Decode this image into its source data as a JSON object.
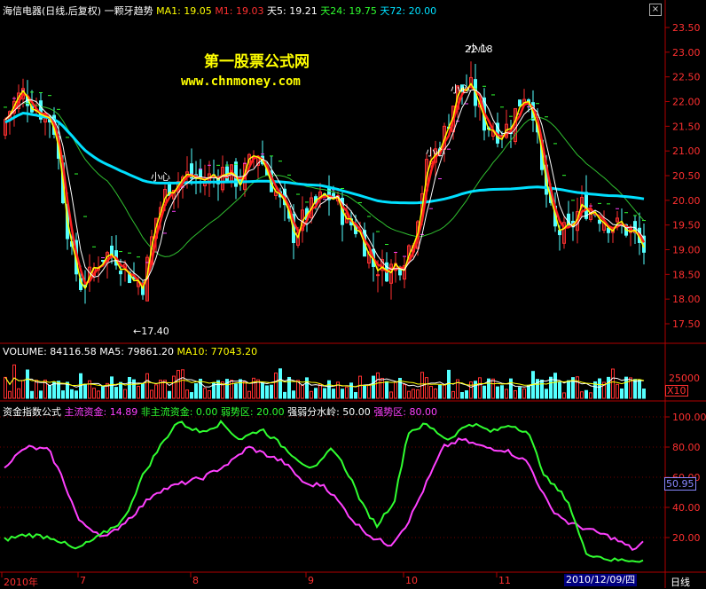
{
  "header": {
    "stock_name": "海信电器(日线,后复权)",
    "indicator": "一颗牙趋势",
    "ma1": "MA1: 19.05",
    "m1": "M1: 19.03",
    "tian5": "天5: 19.21",
    "tian24": "天24: 19.75",
    "tian72": "天72: 20.00"
  },
  "watermark": {
    "line1": "第一股票公式网",
    "line2": "www.chnmoney.com"
  },
  "price_axis": [
    "23.50",
    "23.00",
    "22.50",
    "22.00",
    "21.50",
    "21.00",
    "20.50",
    "20.00",
    "19.50",
    "19.00",
    "18.50",
    "18.00",
    "17.50"
  ],
  "price_annotations": {
    "high": "22.18",
    "low": "←17.40",
    "xiaoxin": "小心"
  },
  "volume_panel": {
    "volume": "VOLUME: 84116.58",
    "ma5": "MA5: 79861.20",
    "ma10": "MA10: 77043.20",
    "axis_value": "25000",
    "multiplier": "X10"
  },
  "indicator_panel": {
    "name": "资金指数公式",
    "main": "主流资金: 14.89",
    "nonmain": "非主流资金: 0.00",
    "weak": "弱势区: 20.00",
    "divide": "强弱分水岭: 50.00",
    "strong": "强势区: 80.00",
    "axis": [
      "100.00",
      "80.00",
      "60.00",
      "40.00",
      "20.00"
    ],
    "current_value": "50.95"
  },
  "date_axis": {
    "labels": [
      "2010年",
      "7",
      "8",
      "9",
      "10",
      "11"
    ],
    "cursor_date": "2010/12/09/四",
    "period": "日线"
  },
  "colors": {
    "up": "#ff3030",
    "down": "#54ffff",
    "ma72": "#00e0ff",
    "main_fund": "#ff40ff",
    "nonmain_fund": "#30ff30"
  }
}
